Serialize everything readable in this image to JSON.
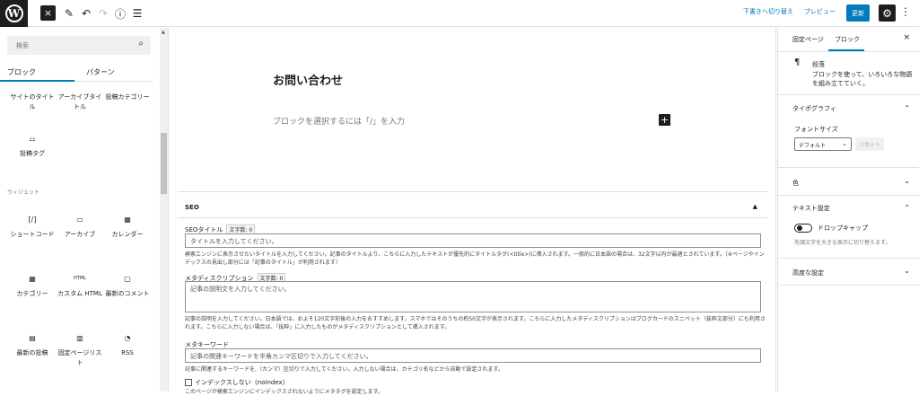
{
  "topbar": {
    "close_icon": "×",
    "tools_icon": "✎",
    "undo_icon": "↶",
    "redo_icon": "↷",
    "info_icon": "ⓘ",
    "list_icon": "☰",
    "save_draft": "下書きへ切り替え",
    "preview": "プレビュー",
    "update": "更新",
    "settings_icon": "⚙",
    "more_icon": "⋮"
  },
  "inserter": {
    "search_placeholder": "検索",
    "tab_blocks": "ブロック",
    "tab_patterns": "パターン",
    "widget_heading": "ウィジェット",
    "blocks": [
      {
        "label": "サイトのタイトル",
        "icon": ""
      },
      {
        "label": "アーカイブタイトル",
        "icon": ""
      },
      {
        "label": "投稿カテゴリー",
        "icon": ""
      },
      {
        "label": "投稿タグ",
        "icon": "⚏"
      },
      {
        "label": "ショートコード",
        "icon": "[/]"
      },
      {
        "label": "アーカイブ",
        "icon": "▭"
      },
      {
        "label": "カレンダー",
        "icon": "▦"
      },
      {
        "label": "カテゴリー",
        "icon": "▦"
      },
      {
        "label": "カスタム HTML",
        "icon": "HTML"
      },
      {
        "label": "最新のコメント",
        "icon": "▢"
      },
      {
        "label": "最新の投稿",
        "icon": "▤"
      },
      {
        "label": "固定ページリスト",
        "icon": "▥"
      },
      {
        "label": "RSS",
        "icon": "◔"
      }
    ]
  },
  "editor": {
    "page_title": "お問い合わせ",
    "block_placeholder": "ブロックを選択するには「/」を入力",
    "add_block_icon": "+"
  },
  "seo": {
    "heading": "SEO",
    "caret": "▲",
    "title_label": "SEOタイトル",
    "title_count": "文字数: 0",
    "title_placeholder": "タイトルを入力してください。",
    "title_help": "検索エンジンに表示させたいタイトルを入力してください。記事のタイトルより、こちらに入力したテキストが優先的にタイトルタグ(<title>)に挿入されます。一般的に日本語の場合は、32文字以内が最適とされています。（※ページやインデックスの見出し部分には「記事のタイトル」が利用されます）",
    "desc_label": "メタディスクリプション",
    "desc_count": "文字数: 0",
    "desc_placeholder": "記事の説明文を入力してください。",
    "desc_help": "記事の説明を入力してください。日本語では、およそ120文字前後の入力をおすすめします。スマホではそのうちの約50文字が表示されます。こちらに入力したメタディスクリプションはブログカードのスニペット（抜粋文部分）にも利用されます。こちらに入力しない場合は、「抜粋」に入力したものがメタディスクリプションとして挿入されます。",
    "kw_label": "メタキーワード",
    "kw_placeholder": "記事の関連キーワードを半角カンマ区切りで入力してください。",
    "kw_help": "記事に関連するキーワードを,（カンマ）区切りで入力してください。入力しない場合は、カテゴリ名などから自動で設定されます。",
    "noindex_label": "インデックスしない（noindex）",
    "noindex_help": "このページが検索エンジンにインデックスされないようにメタタグを設定します。"
  },
  "sidebar": {
    "tab_page": "固定ページ",
    "tab_block": "ブロック",
    "close_icon": "×",
    "block_icon": "¶",
    "block_name": "段落",
    "block_desc": "ブロックを使って、いろいろな物語を組み立てていく。",
    "typography_heading": "タイポグラフィ",
    "typography_chevron": "⌃",
    "font_size_label": "フォントサイズ",
    "font_size_value": "デフォルト",
    "reset_label": "リセット",
    "color_heading": "色",
    "text_settings_heading": "テキスト設定",
    "drop_cap_label": "ドロップキャップ",
    "drop_cap_help": "先頭文字を大きな表示に切り替えます。",
    "advanced_heading": "高度な設定",
    "chevron_down": "⌄",
    "chevron_up": "⌃"
  }
}
